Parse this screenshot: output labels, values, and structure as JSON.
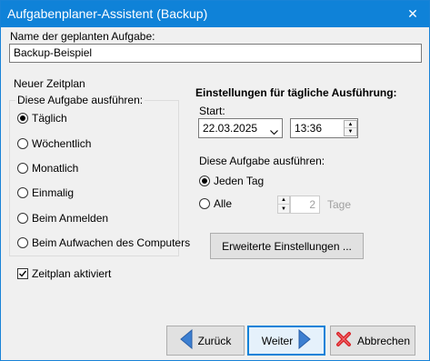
{
  "window": {
    "title": "Aufgabenplaner-Assistent (Backup)",
    "close_glyph": "✕"
  },
  "task_name": {
    "label": "Name der geplanten Aufgabe:",
    "value": "Backup-Beispiel"
  },
  "schedule": {
    "heading": "Neuer Zeitplan",
    "group_label": "Diese Aufgabe ausführen:",
    "options": [
      {
        "label": "Täglich",
        "checked": true
      },
      {
        "label": "Wöchentlich",
        "checked": false
      },
      {
        "label": "Monatlich",
        "checked": false
      },
      {
        "label": "Einmalig",
        "checked": false
      },
      {
        "label": "Beim Anmelden",
        "checked": false
      },
      {
        "label": "Beim Aufwachen des Computers",
        "checked": false
      }
    ],
    "enabled_label": "Zeitplan aktiviert",
    "enabled_checked": true
  },
  "daily": {
    "heading": "Einstellungen für tägliche Ausführung:",
    "start_label": "Start:",
    "date": "22.03.2025",
    "time": "13:36",
    "run_label": "Diese Aufgabe ausführen:",
    "every_day_label": "Jeden Tag",
    "every_label": "Alle",
    "days_value": "2",
    "days_unit": "Tage",
    "advanced_button": "Erweiterte Einstellungen ..."
  },
  "buttons": {
    "back": "Zurück",
    "next": "Weiter",
    "cancel": "Abbrechen"
  },
  "colors": {
    "titlebar": "#0f82d8",
    "arrow_blue": "#3c7fd1",
    "cancel_red": "#d9252a"
  }
}
